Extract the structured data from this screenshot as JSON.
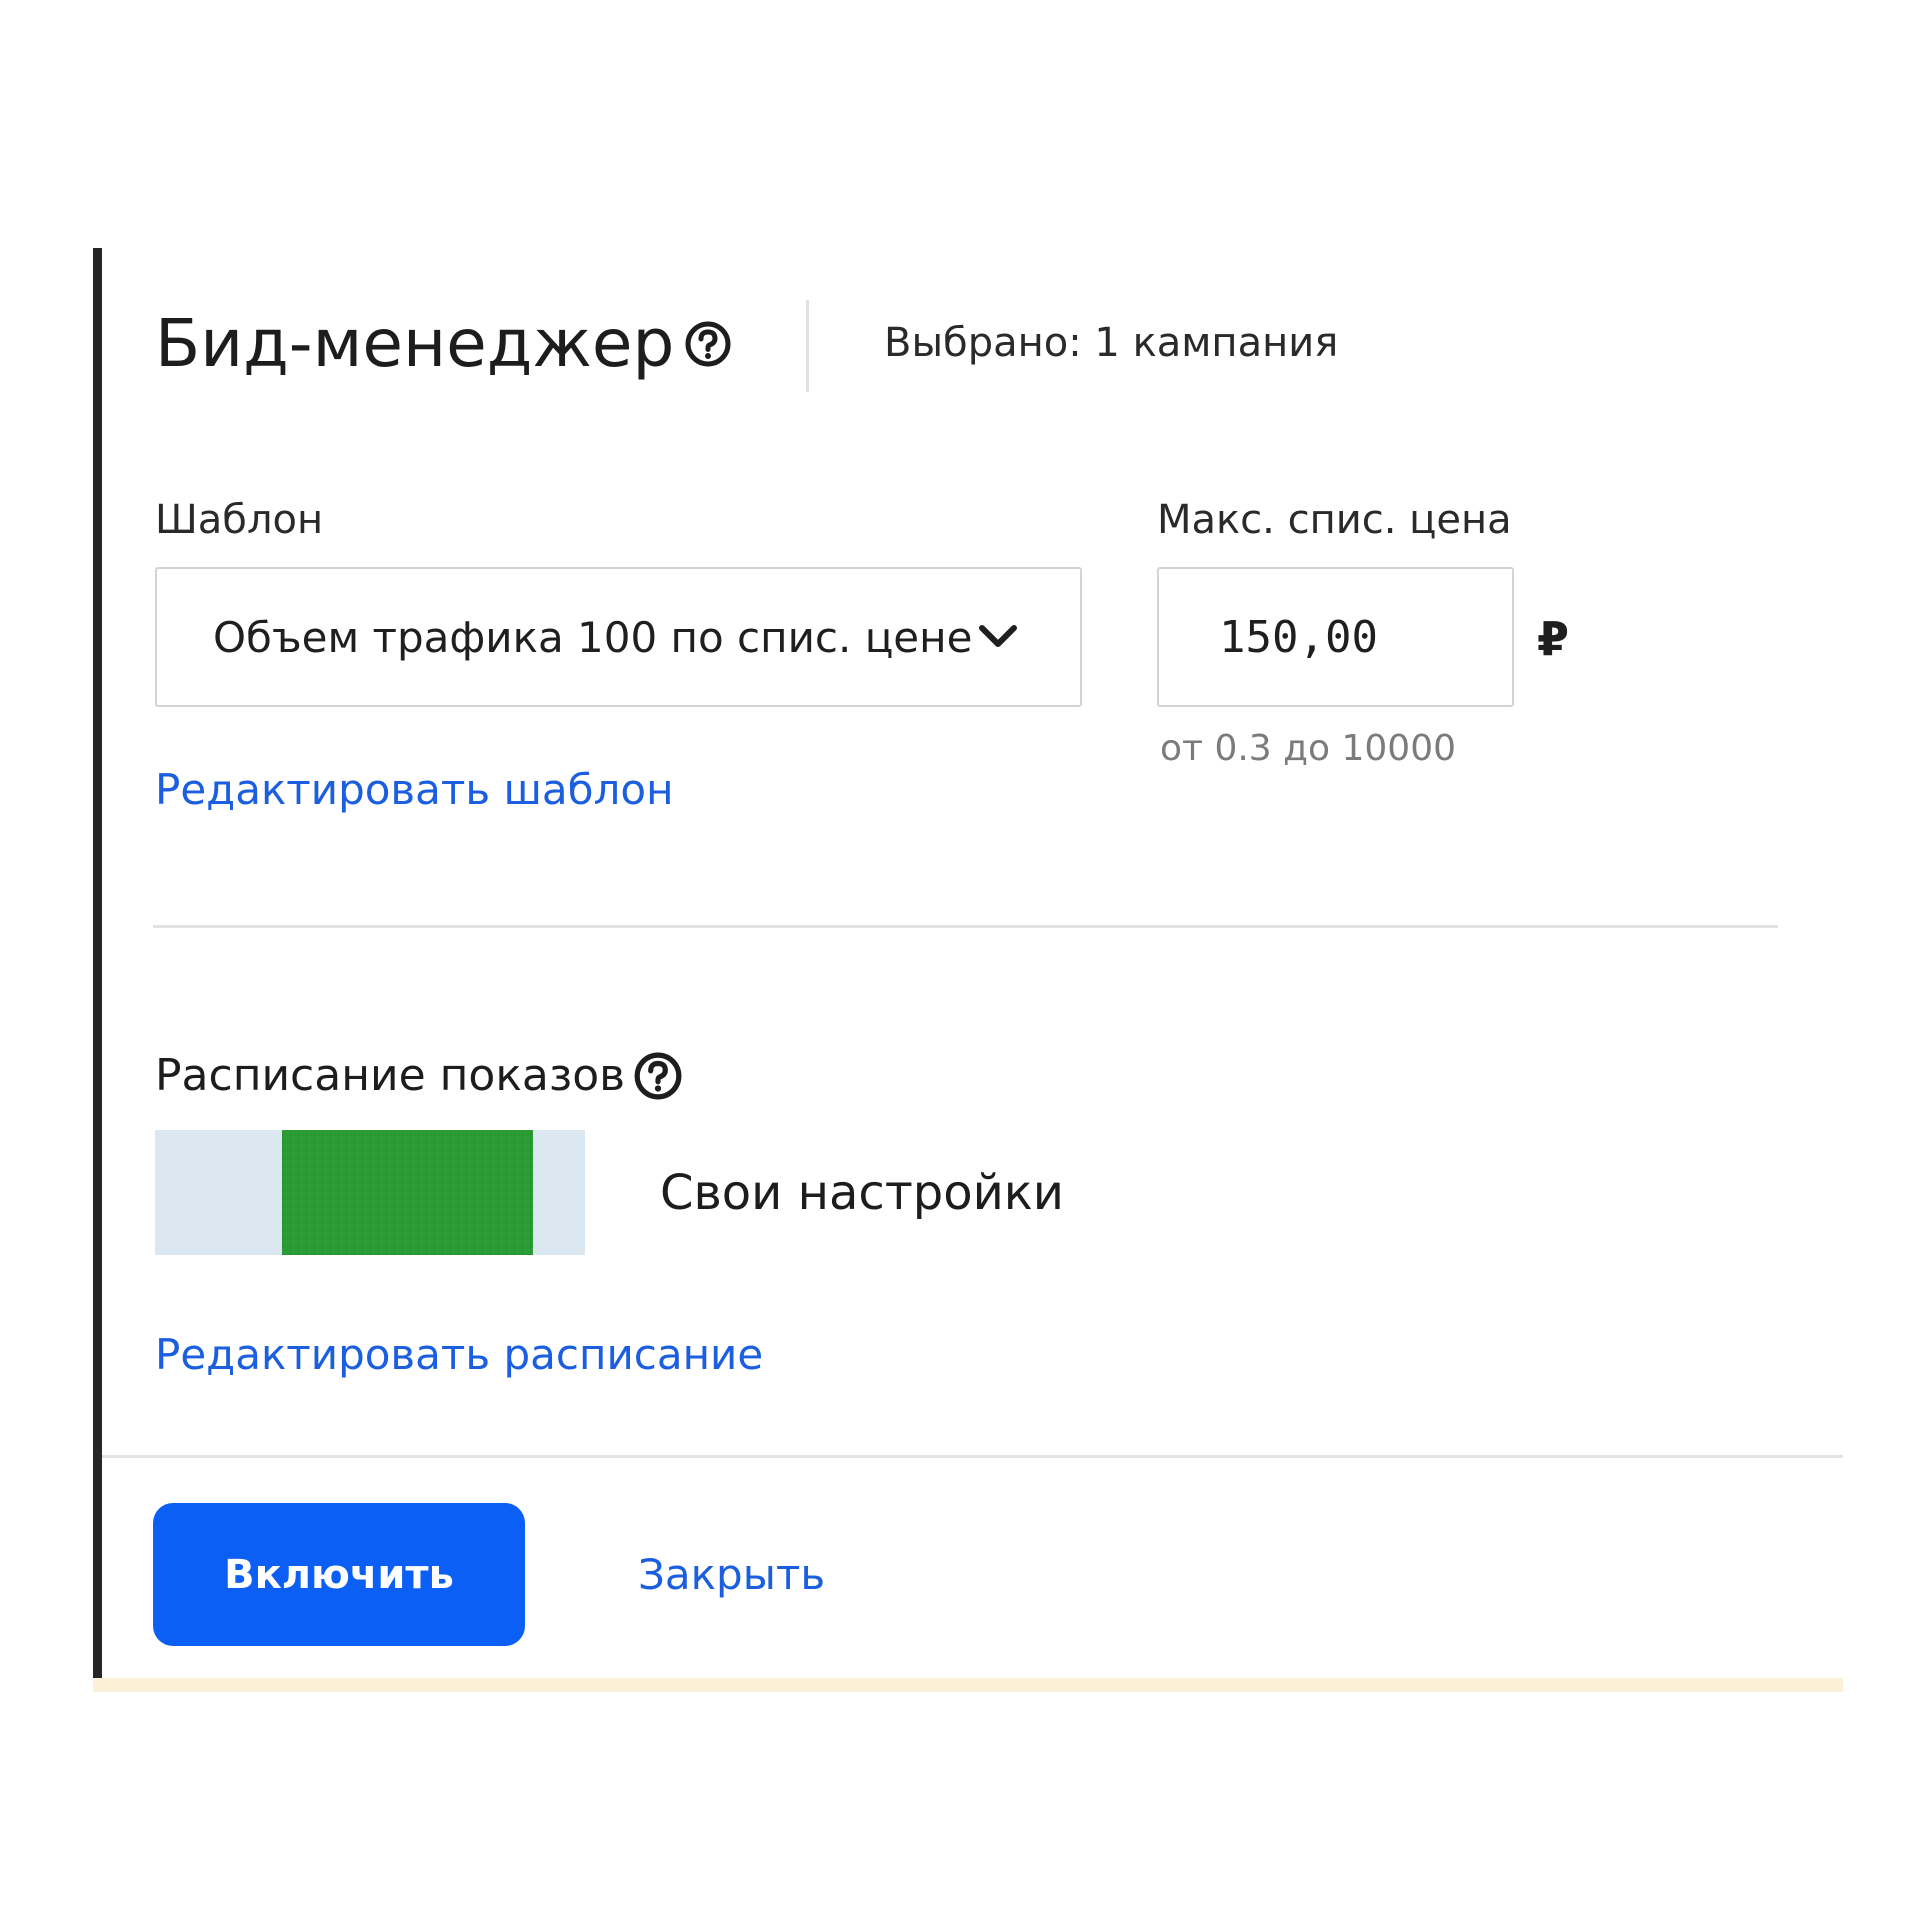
{
  "header": {
    "title": "Бид-менеджер",
    "selected_info": "Выбрано: 1 кампания"
  },
  "template": {
    "label": "Шаблон",
    "selected_value": "Объем трафика 100 по спис. цене",
    "edit_link": "Редактировать шаблон"
  },
  "max_price": {
    "label": "Макс. спис. цена",
    "value": "150,00",
    "currency": "₽",
    "hint": "от 0.3 до 10000"
  },
  "schedule": {
    "title": "Расписание показов",
    "mode": "Свои настройки",
    "active_range_fraction": [
      0.295,
      0.88
    ],
    "edit_link": "Редактировать расписание"
  },
  "footer": {
    "enable_label": "Включить",
    "close_label": "Закрыть"
  },
  "colors": {
    "primary": "#0b5ff5",
    "link": "#1b5fe0",
    "schedule_active": "#2a9d35",
    "schedule_inactive": "#dce8f1"
  },
  "icons": {
    "title_help": "question-circle-icon",
    "schedule_help": "question-circle-icon",
    "select_chevron": "chevron-down-icon"
  }
}
